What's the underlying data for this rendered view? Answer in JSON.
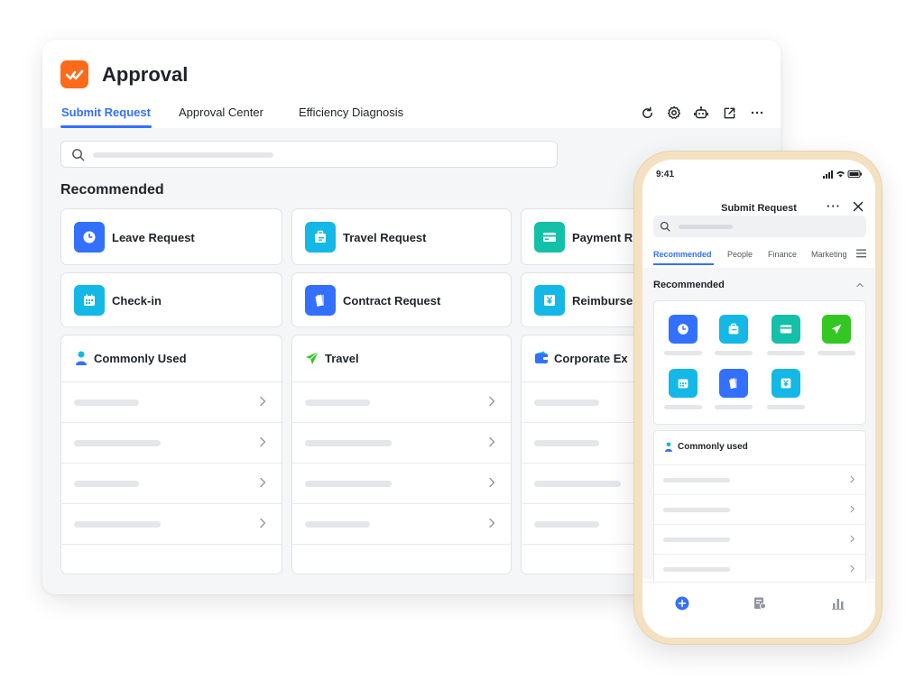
{
  "app": {
    "title": "Approval",
    "brand_color": "#ff6a1a",
    "accent_color": "#3370ff"
  },
  "tabs": [
    {
      "label": "Submit Request",
      "active": true
    },
    {
      "label": "Approval Center",
      "active": false
    },
    {
      "label": "Efficiency Diagnosis",
      "active": false
    }
  ],
  "toolbar": {
    "icons": [
      "refresh-icon",
      "settings-icon",
      "bot-icon",
      "open-external-icon",
      "more-icon"
    ]
  },
  "search": {
    "placeholder": ""
  },
  "recommended": {
    "title": "Recommended",
    "items": [
      {
        "label": "Leave Request",
        "icon": "clock-icon",
        "color": "#3370ff"
      },
      {
        "label": "Travel Request",
        "icon": "briefcase-icon",
        "color": "#14b8e6"
      },
      {
        "label": "Payment R",
        "icon": "card-icon",
        "color": "#14c0a8"
      },
      {
        "label": "Check-in",
        "icon": "calendar-icon",
        "color": "#14b8e6"
      },
      {
        "label": "Contract Request",
        "icon": "document-icon",
        "color": "#3370ff"
      },
      {
        "label": "Reimburser",
        "icon": "yen-icon",
        "color": "#14b8e6"
      }
    ]
  },
  "groups": [
    {
      "title": "Commonly Used",
      "icon": "person-icon",
      "rows": 4
    },
    {
      "title": "Travel",
      "icon": "plane-icon",
      "rows": 4
    },
    {
      "title": "Corporate Ex",
      "icon": "wallet-icon",
      "rows": 4
    }
  ],
  "phone": {
    "time": "9:41",
    "title": "Submit Request",
    "tabs": [
      {
        "label": "Recommended",
        "active": true
      },
      {
        "label": "People",
        "active": false
      },
      {
        "label": "Finance",
        "active": false
      },
      {
        "label": "Marketing",
        "active": false
      }
    ],
    "section_title": "Recommended",
    "apps": [
      {
        "icon": "clock-icon",
        "color": "#3370ff"
      },
      {
        "icon": "briefcase-icon",
        "color": "#14b8e6"
      },
      {
        "icon": "card-icon",
        "color": "#14c0a8"
      },
      {
        "icon": "plane-icon",
        "color": "#34c724"
      },
      {
        "icon": "calendar-icon",
        "color": "#14b8e6"
      },
      {
        "icon": "document-icon",
        "color": "#3370ff"
      },
      {
        "icon": "yen-icon",
        "color": "#14b8e6"
      }
    ],
    "common_title": "Commonly used",
    "nav": [
      "add-icon",
      "approval-icon",
      "stats-icon"
    ]
  }
}
